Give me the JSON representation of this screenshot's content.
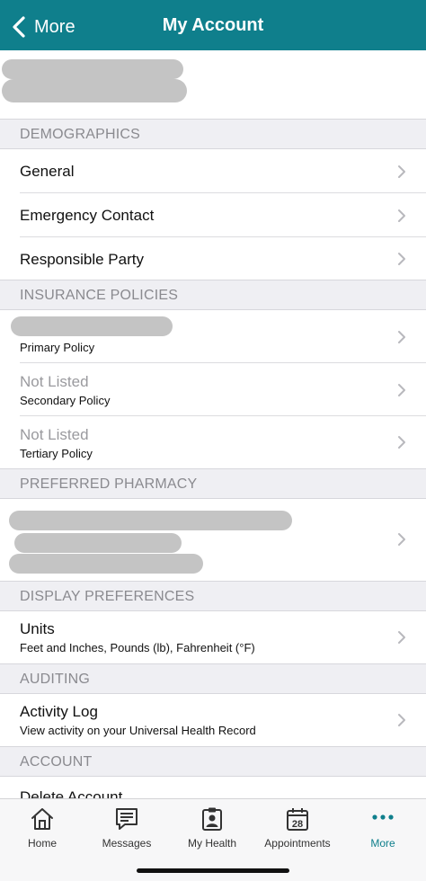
{
  "nav": {
    "back_label": "More",
    "title": "My Account"
  },
  "sections": {
    "demographics": "DEMOGRAPHICS",
    "insurance": "INSURANCE POLICIES",
    "pharmacy": "PREFERRED PHARMACY",
    "display": "DISPLAY PREFERENCES",
    "auditing": "AUDITING",
    "account": "ACCOUNT"
  },
  "demographics": {
    "general": "General",
    "emergency": "Emergency Contact",
    "responsible": "Responsible Party"
  },
  "insurance": {
    "primary_sub": "Primary Policy",
    "secondary_title": "Not Listed",
    "secondary_sub": "Secondary Policy",
    "tertiary_title": "Not Listed",
    "tertiary_sub": "Tertiary Policy"
  },
  "display": {
    "units_title": "Units",
    "units_sub": "Feet and Inches, Pounds (lb), Fahrenheit (°F)"
  },
  "auditing": {
    "activity_title": "Activity Log",
    "activity_sub": "View activity on your Universal Health Record"
  },
  "account": {
    "delete_label": "Delete Account"
  },
  "tabbar": {
    "home": "Home",
    "messages": "Messages",
    "my_health": "My Health",
    "appointments": "Appointments",
    "appointments_date": "28",
    "more": "More"
  },
  "colors": {
    "brand": "#0f7f8c",
    "section_bg": "#efeff3",
    "muted_text": "#9a9a9e"
  }
}
